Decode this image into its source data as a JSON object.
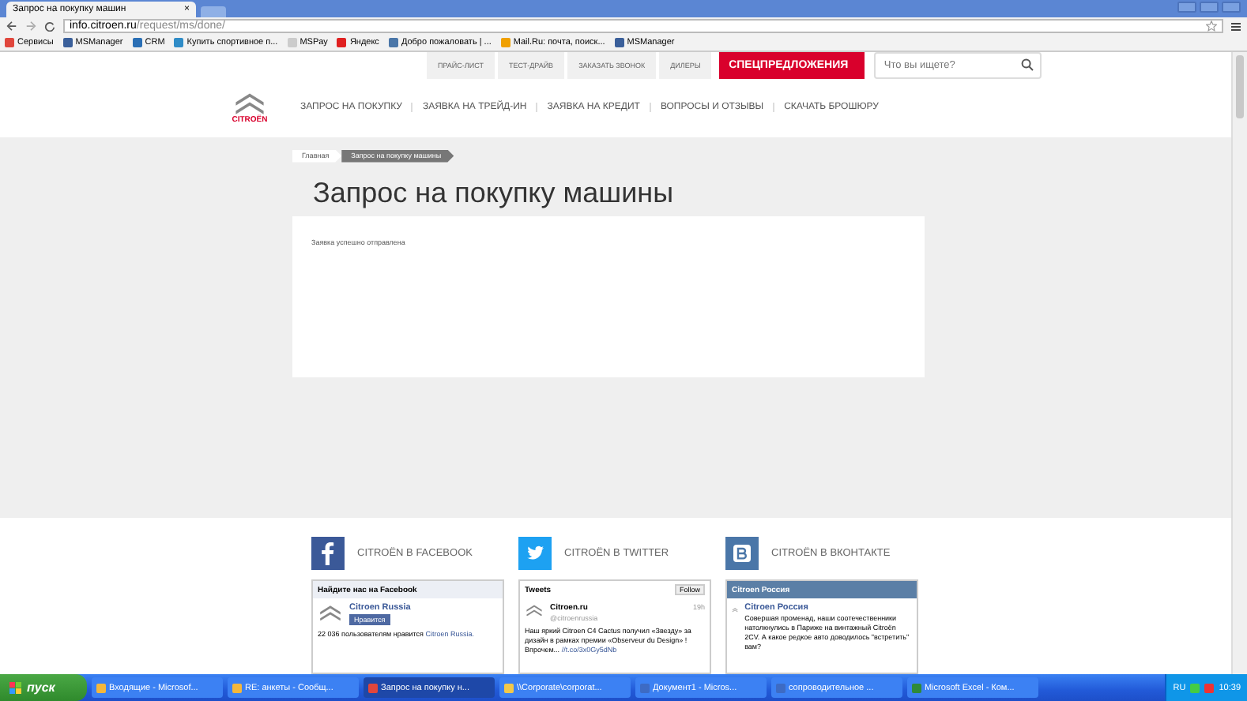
{
  "browser": {
    "tab": {
      "title": "Запрос на покупку машин",
      "close": "×"
    },
    "url": {
      "domain": "info.citroen.ru",
      "path": "/request/ms/done/"
    },
    "bookmarks": [
      {
        "label": "Сервисы",
        "kind": "apps"
      },
      {
        "label": "MSManager",
        "kind": "ms"
      },
      {
        "label": "CRM",
        "kind": "crm"
      },
      {
        "label": "Купить спортивное п...",
        "kind": "site"
      },
      {
        "label": "MSPay",
        "kind": "page"
      },
      {
        "label": "Яндекс",
        "kind": "yandex"
      },
      {
        "label": "Добро пожаловать | ...",
        "kind": "vk"
      },
      {
        "label": "Mail.Ru: почта, поиск...",
        "kind": "mail"
      },
      {
        "label": "MSManager",
        "kind": "ms"
      }
    ]
  },
  "site": {
    "top_links": [
      "ПРАЙС-ЛИСТ",
      "ТЕСТ-ДРАЙВ",
      "ЗАКАЗАТЬ ЗВОНОК",
      "ДИЛЕРЫ"
    ],
    "special_button": "СПЕЦПРЕДЛОЖЕНИЯ",
    "search": {
      "placeholder": "Что вы ищете?"
    },
    "logo_text": "CITROËN",
    "main_nav": [
      "ЗАПРОС НА ПОКУПКУ",
      "ЗАЯВКА НА ТРЕЙД-ИН",
      "ЗАЯВКА НА КРЕДИТ",
      "ВОПРОСЫ И ОТЗЫВЫ",
      "СКАЧАТЬ БРОШЮРУ"
    ],
    "breadcrumb": [
      {
        "label": "Главная",
        "selected": false
      },
      {
        "label": "Запрос на покупку машины",
        "selected": true
      }
    ],
    "page_title": "Запрос на покупку машины",
    "message": "Заявка успешно отправлена",
    "social": [
      {
        "kind": "facebook",
        "title": "CITROËN В FACEBOOK"
      },
      {
        "kind": "twitter",
        "title": "CITROËN В TWITTER"
      },
      {
        "kind": "vk",
        "title": "CITROËN В ВКОНТАКТЕ"
      }
    ],
    "facebook_widget": {
      "header": "Найдите нас на Facebook",
      "page_name": "Citroen Russia",
      "like_button": "Нравится",
      "likes_text": "22 036 пользователям нравится ",
      "likes_link": "Citroen Russia."
    },
    "twitter_widget": {
      "header": "Tweets",
      "follow_button": "Follow",
      "name": "Citroen.ru",
      "handle": "@citroenrussia",
      "time": "19h",
      "text": "Наш яркий Citroen C4 Cactus получил «Звезду» за дизайн в рамках премии «Observeur du Design» ! Впрочем...",
      "link": "//t.co/3x0Gy5dNb"
    },
    "vk_widget": {
      "header": "Citroen Россия",
      "author": "Citroen Россия",
      "text": "Совершая променад, наши соотечественники натолкнулись в Париже на винтажный Citroën 2CV. А какое редкое авто доводилось \"встретить\" вам?"
    }
  },
  "taskbar": {
    "start": "пуск",
    "tasks": [
      {
        "label": "Входящие - Microsof...",
        "kind": "outlook",
        "selected": false
      },
      {
        "label": "RE: анкеты - Сообщ...",
        "kind": "outlook",
        "selected": false
      },
      {
        "label": "Запрос на покупку н...",
        "kind": "chrome",
        "selected": true
      },
      {
        "label": "\\\\Corporate\\corporat...",
        "kind": "folder",
        "selected": false
      },
      {
        "label": "Документ1 - Micros...",
        "kind": "word",
        "selected": false
      },
      {
        "label": "сопроводительное ...",
        "kind": "word",
        "selected": false
      },
      {
        "label": "Microsoft Excel - Ком...",
        "kind": "excel",
        "selected": false
      }
    ],
    "lang": "RU",
    "clock": "10:39"
  }
}
